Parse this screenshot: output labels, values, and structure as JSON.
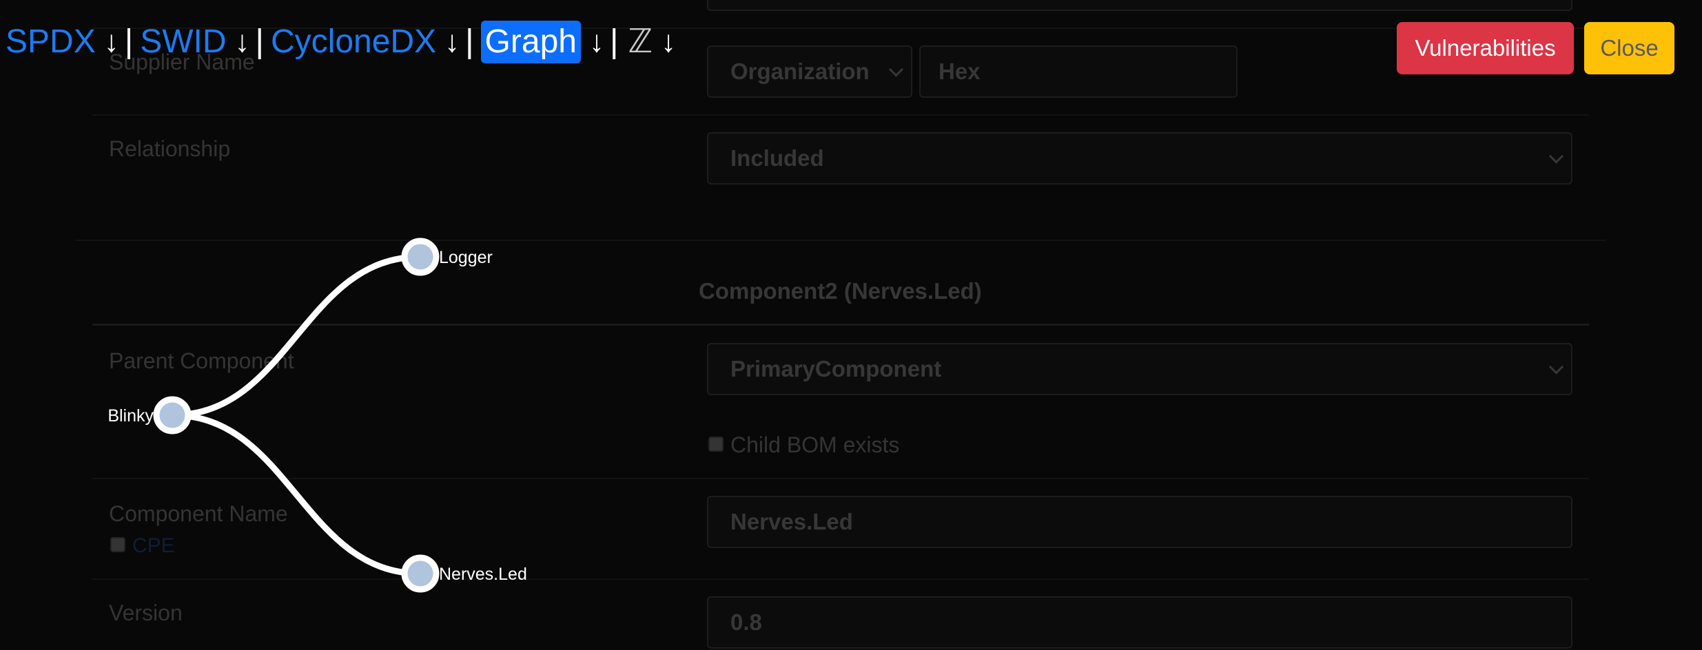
{
  "nav": {
    "formats": [
      {
        "label": "SPDX"
      },
      {
        "label": "SWID"
      },
      {
        "label": "CycloneDX"
      },
      {
        "label": "Graph",
        "active": true
      }
    ],
    "download_glyph": "↓",
    "separator": "|",
    "zset_glyph": "ℤ"
  },
  "buttons": {
    "vulnerabilities": "Vulnerabilities",
    "close": "Close"
  },
  "form": {
    "supplier_name_label": "Supplier Name",
    "supplier_type_value": "Organization",
    "supplier_name_value": "Hex",
    "relationship_label": "Relationship",
    "relationship_value": "Included",
    "section_title": "Component2 (Nerves.Led)",
    "parent_component_label": "Parent Component",
    "parent_component_value": "PrimaryComponent",
    "child_bom_label": "Child BOM exists",
    "component_name_label": "Component Name",
    "cpe_label": "CPE",
    "component_name_value": "Nerves.Led",
    "version_label": "Version",
    "version_value": "0.8"
  },
  "graph": {
    "root": "Blinky",
    "children": [
      "Logger",
      "Nerves.Led"
    ]
  },
  "colors": {
    "link": "#1a7cf5",
    "active_bg": "#0d6efd",
    "danger": "#dc3545",
    "warning": "#ffc107",
    "node_fill": "#b0c4de",
    "edge": "#ffffff"
  }
}
